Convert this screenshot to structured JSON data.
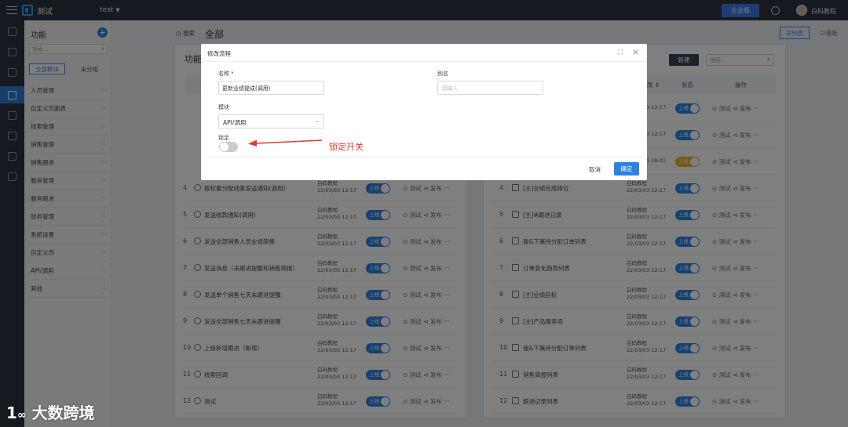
{
  "topbar": {
    "app_title": "测试",
    "project": "test",
    "enterprise": "企业版",
    "username": "白码教程"
  },
  "funcpanel": {
    "title": "功能",
    "search_placeholder": "搜索...",
    "tabs": [
      "全部模块",
      "未分组"
    ],
    "modules": [
      "人员管理",
      "自定义页面表",
      "线索管理",
      "销售管理",
      "销售跟进",
      "服务管理",
      "服务跟进",
      "财务管理",
      "系统设置",
      "自定义页",
      "API/调用",
      "其他"
    ]
  },
  "page": {
    "search_label": "搜索",
    "title": "全部",
    "view_list": "列表",
    "view_board": "看板"
  },
  "left_card": {
    "title": "功能",
    "rows": [
      {
        "no": "4",
        "name": "按权重分配线索发送通知(调用)"
      },
      {
        "no": "5",
        "name": "发送收款通知(调用)"
      },
      {
        "no": "6",
        "name": "发送全部销售人员业绩简报"
      },
      {
        "no": "7",
        "name": "发送消息（未跟进提醒和销售简报）"
      },
      {
        "no": "8",
        "name": "发送单个销售七天未跟进提醒"
      },
      {
        "no": "9",
        "name": "发送全部销售七天未跟进提醒"
      },
      {
        "no": "10",
        "name": "上级新增跟进（新增）"
      },
      {
        "no": "11",
        "name": "线索回调"
      },
      {
        "no": "12",
        "name": "测试"
      }
    ]
  },
  "right_card": {
    "new_button": "新建",
    "search_placeholder": "搜索...",
    "col_modified": "改",
    "col_status": "状态",
    "col_ops": "操作",
    "top_rows": [
      {
        "time": "22/03/03 12:17",
        "status": "上线"
      },
      {
        "time": "22/03/03 12:17",
        "status": "上线"
      },
      {
        "time": "22/03/03 18:01",
        "status": "上线"
      }
    ],
    "rows": [
      {
        "no": "4",
        "name": "[主]业绩完成排位"
      },
      {
        "no": "5",
        "name": "[主]#跟进记录"
      },
      {
        "no": "6",
        "name": "我&下属待分配订单列表"
      },
      {
        "no": "7",
        "name": "订单变化趋势列表"
      },
      {
        "no": "8",
        "name": "[主]业绩目标"
      },
      {
        "no": "9",
        "name": "[主]产品服务项"
      },
      {
        "no": "10",
        "name": "我&下属待分配订单列表"
      },
      {
        "no": "11",
        "name": "销售简报列表"
      },
      {
        "no": "12",
        "name": "跟进记录列表"
      }
    ]
  },
  "row_common": {
    "author": "白码教程",
    "time": "22/03/03 12:17",
    "status": "上线",
    "op_test": "⊙ 测试",
    "op_publish": "⊲ 发布",
    "more": "···"
  },
  "modal": {
    "title": "修改流程",
    "name_label": "名称 *",
    "name_value": "更新业绩提成(调用)",
    "alias_label": "别名",
    "alias_placeholder": "请输入",
    "module_label": "模块",
    "module_value": "API/调用",
    "lock_label": "锁定",
    "cancel": "取消",
    "ok": "确定"
  },
  "annotation": "锁定开关",
  "watermark": "大数跨境",
  "colors": {
    "primary": "#2b82e0",
    "topbar": "#2d3340",
    "annotation": "#e03a2f",
    "toggle_on": "#2b82e0",
    "toggle_warn": "#f0b12c"
  }
}
